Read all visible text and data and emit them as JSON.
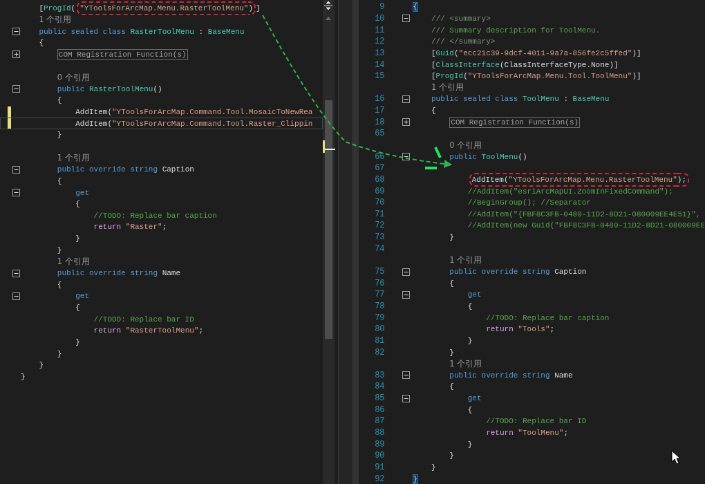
{
  "left_pane": {
    "lines": [
      {
        "children": [
          {
            "changed": false,
            "current": false,
            "tokens": [
              {
                "text": "[",
                "kind": "plain",
                "outlined": false
              },
              {
                "text": "ProgId",
                "kind": "type",
                "outlined": false
              },
              {
                "text": "(",
                "kind": "plain",
                "outlined": false
              },
              {
                "text": "\"YToolsForArcMap.Menu.RasterToolMenu\"",
                "kind": "string",
                "outlined": true
              },
              {
                "text": ")",
                "kind": "plain",
                "outlined": true
              },
              {
                "text": "]",
                "kind": "plain",
                "outlined": false
              }
            ]
          },
          {
            "changed": false,
            "current": false,
            "tokens": [
              {
                "text": "1 个引用",
                "kind": "codelens"
              }
            ]
          },
          {
            "changed": false,
            "current": false,
            "collapsed": false,
            "tokens": [
              {
                "text": "public sealed class ",
                "kind": "keyword"
              },
              {
                "text": "RasterToolMenu",
                "kind": "type"
              },
              {
                "text": " : ",
                "kind": "plain"
              },
              {
                "text": "BaseMenu",
                "kind": "type"
              }
            ]
          },
          {
            "changed": false,
            "current": false,
            "tokens": [
              {
                "text": "{",
                "kind": "plain"
              }
            ],
            "children": [
              {
                "changed": false,
                "current": false,
                "collapsed": true,
                "tokens": [
                  {
                    "text": "COM Registration Function(s)",
                    "kind": "region"
                  }
                ]
              },
              {
                "changed": false,
                "current": false
              },
              {
                "changed": false,
                "current": false,
                "tokens": [
                  {
                    "text": "0 个引用",
                    "kind": "codelens"
                  }
                ]
              },
              {
                "changed": false,
                "current": false,
                "collapsed": false,
                "tokens": [
                  {
                    "text": "public ",
                    "kind": "keyword"
                  },
                  {
                    "text": "RasterToolMenu",
                    "kind": "type"
                  },
                  {
                    "text": "()",
                    "kind": "plain"
                  }
                ]
              },
              {
                "changed": false,
                "current": false,
                "tokens": [
                  {
                    "text": "{",
                    "kind": "plain"
                  }
                ],
                "children": [
                  {
                    "changed": true,
                    "current": false,
                    "tokens": [
                      {
                        "text": "AddItem(",
                        "kind": "plain"
                      },
                      {
                        "text": "\"YToolsForArcMap.Command.Tool.MosaicToNewRea",
                        "kind": "string"
                      }
                    ]
                  },
                  {
                    "changed": true,
                    "current": true,
                    "tokens": [
                      {
                        "text": "AddItem(",
                        "kind": "plain"
                      },
                      {
                        "text": "\"YToolsForArcMap.Command.Tool.Raster_Clippin",
                        "kind": "string"
                      }
                    ]
                  }
                ]
              },
              {
                "changed": false,
                "current": false,
                "tokens": [
                  {
                    "text": "}",
                    "kind": "plain"
                  }
                ]
              },
              {
                "changed": false,
                "current": false
              },
              {
                "changed": false,
                "current": false,
                "tokens": [
                  {
                    "text": "1 个引用",
                    "kind": "codelens"
                  }
                ]
              },
              {
                "changed": false,
                "current": false,
                "collapsed": false,
                "tokens": [
                  {
                    "text": "public override string ",
                    "kind": "keyword"
                  },
                  {
                    "text": "Caption",
                    "kind": "plain"
                  }
                ]
              },
              {
                "changed": false,
                "current": false,
                "tokens": [
                  {
                    "text": "{",
                    "kind": "plain"
                  }
                ],
                "children": [
                  {
                    "changed": false,
                    "current": false,
                    "collapsed": false,
                    "tokens": [
                      {
                        "text": "get",
                        "kind": "keyword"
                      }
                    ]
                  },
                  {
                    "changed": false,
                    "current": false,
                    "tokens": [
                      {
                        "text": "{",
                        "kind": "plain"
                      }
                    ],
                    "children": [
                      {
                        "changed": false,
                        "current": false,
                        "tokens": [
                          {
                            "text": "//TODO: Replace bar caption",
                            "kind": "comment"
                          }
                        ]
                      },
                      {
                        "changed": false,
                        "current": false,
                        "tokens": [
                          {
                            "text": "return ",
                            "kind": "control"
                          },
                          {
                            "text": "\"Raster\"",
                            "kind": "string"
                          },
                          {
                            "text": ";",
                            "kind": "plain"
                          }
                        ]
                      }
                    ]
                  },
                  {
                    "changed": false,
                    "current": false,
                    "tokens": [
                      {
                        "text": "}",
                        "kind": "plain"
                      }
                    ]
                  }
                ]
              },
              {
                "changed": false,
                "current": false,
                "tokens": [
                  {
                    "text": "}",
                    "kind": "plain"
                  }
                ]
              },
              {
                "changed": false,
                "current": false,
                "tokens": [
                  {
                    "text": "1 个引用",
                    "kind": "codelens"
                  }
                ]
              },
              {
                "changed": false,
                "current": false,
                "collapsed": false,
                "tokens": [
                  {
                    "text": "public override string ",
                    "kind": "keyword"
                  },
                  {
                    "text": "Name",
                    "kind": "plain"
                  }
                ]
              },
              {
                "changed": false,
                "current": false,
                "tokens": [
                  {
                    "text": "{",
                    "kind": "plain"
                  }
                ],
                "children": [
                  {
                    "changed": false,
                    "current": false,
                    "collapsed": false,
                    "tokens": [
                      {
                        "text": "get",
                        "kind": "keyword"
                      }
                    ]
                  },
                  {
                    "changed": false,
                    "current": false,
                    "tokens": [
                      {
                        "text": "{",
                        "kind": "plain"
                      }
                    ],
                    "children": [
                      {
                        "changed": false,
                        "current": false,
                        "tokens": [
                          {
                            "text": "//TODO: Replace bar ID",
                            "kind": "comment"
                          }
                        ]
                      },
                      {
                        "changed": false,
                        "current": false,
                        "tokens": [
                          {
                            "text": "return ",
                            "kind": "control"
                          },
                          {
                            "text": "\"RasterToolMenu\"",
                            "kind": "string"
                          },
                          {
                            "text": ";",
                            "kind": "plain"
                          }
                        ]
                      }
                    ]
                  },
                  {
                    "changed": false,
                    "current": false,
                    "tokens": [
                      {
                        "text": "}",
                        "kind": "plain"
                      }
                    ]
                  }
                ]
              },
              {
                "changed": false,
                "current": false,
                "tokens": [
                  {
                    "text": "}",
                    "kind": "plain"
                  }
                ]
              }
            ]
          },
          {
            "changed": false,
            "current": false,
            "tokens": [
              {
                "text": "}",
                "kind": "plain"
              }
            ]
          }
        ]
      },
      {
        "changed": false,
        "current": false,
        "tokens": [
          {
            "text": "}",
            "kind": "plain"
          }
        ]
      }
    ]
  },
  "right_pane": {
    "lines": [
      {
        "number": "9",
        "tokens": [
          {
            "text": "{",
            "kind": "brace-match"
          }
        ],
        "children": [
          {
            "number": "10",
            "collapsed": false,
            "tokens": [
              {
                "text": "/// <summary>",
                "kind": "doc"
              }
            ]
          },
          {
            "number": "11",
            "tokens": [
              {
                "text": "///",
                "kind": "doc"
              },
              {
                "text": " Summary description for ToolMenu.",
                "kind": "comment"
              }
            ]
          },
          {
            "number": "12",
            "tokens": [
              {
                "text": "/// </summary>",
                "kind": "doc"
              }
            ]
          },
          {
            "number": "13",
            "tokens": [
              {
                "text": "[",
                "kind": "plain"
              },
              {
                "text": "Guid",
                "kind": "type"
              },
              {
                "text": "(",
                "kind": "plain"
              },
              {
                "text": "\"ecc21c39-9dcf-4011-9a7a-856fe2c5ffed\"",
                "kind": "string"
              },
              {
                "text": ")]",
                "kind": "plain"
              }
            ]
          },
          {
            "number": "14",
            "tokens": [
              {
                "text": "[",
                "kind": "plain"
              },
              {
                "text": "ClassInterface",
                "kind": "type"
              },
              {
                "text": "(ClassInterfaceType.None)]",
                "kind": "plain"
              }
            ]
          },
          {
            "number": "15",
            "tokens": [
              {
                "text": "[",
                "kind": "plain"
              },
              {
                "text": "ProgId",
                "kind": "type"
              },
              {
                "text": "(",
                "kind": "plain"
              },
              {
                "text": "\"YToolsForArcMap.Menu.Tool.ToolMenu\"",
                "kind": "string"
              },
              {
                "text": ")]",
                "kind": "plain"
              }
            ]
          },
          {
            "tokens": [
              {
                "text": "1 个引用",
                "kind": "codelens"
              }
            ]
          },
          {
            "number": "16",
            "collapsed": false,
            "tokens": [
              {
                "text": "public sealed class ",
                "kind": "keyword"
              },
              {
                "text": "ToolMenu",
                "kind": "type"
              },
              {
                "text": " : ",
                "kind": "plain"
              },
              {
                "text": "BaseMenu",
                "kind": "type"
              }
            ]
          },
          {
            "number": "17",
            "tokens": [
              {
                "text": "{",
                "kind": "plain"
              }
            ],
            "children": [
              {
                "number": "18",
                "collapsed": true,
                "tokens": [
                  {
                    "text": "COM Registration Function(s)",
                    "kind": "region"
                  }
                ]
              },
              {
                "number": "65"
              },
              {
                "tokens": [
                  {
                    "text": "0 个引用",
                    "kind": "codelens"
                  }
                ]
              },
              {
                "number": "66",
                "collapsed": false,
                "tokens": [
                  {
                    "text": "public ",
                    "kind": "keyword"
                  },
                  {
                    "text": "ToolMenu",
                    "kind": "type"
                  },
                  {
                    "text": "()",
                    "kind": "plain"
                  }
                ]
              },
              {
                "number": "67",
                "children": [
                  {
                    "number": "68",
                    "tokens": [
                      {
                        "text": "AddItem(",
                        "kind": "plain",
                        "outlined": true
                      },
                      {
                        "text": "\"YToolsForArcMap.Menu.RasterToolMenu\"",
                        "kind": "string",
                        "outlined": true
                      },
                      {
                        "text": ");",
                        "kind": "plain",
                        "outlined": true
                      }
                    ]
                  },
                  {
                    "number": "69",
                    "tokens": [
                      {
                        "text": "//AddItem(\"esriArcMapUI.ZoomInFixedCommand\");",
                        "kind": "comment"
                      }
                    ]
                  },
                  {
                    "number": "70",
                    "tokens": [
                      {
                        "text": "//BeginGroup(); //Separator",
                        "kind": "comment"
                      }
                    ]
                  },
                  {
                    "number": "71",
                    "tokens": [
                      {
                        "text": "//AddItem(\"{FBF8C3FB-0480-11D2-8D21-080009EE4E51}\",",
                        "kind": "comment"
                      }
                    ]
                  },
                  {
                    "number": "72",
                    "tokens": [
                      {
                        "text": "//AddItem(new Guid(\"FBF8C3FB-0480-11D2-8D21-080009EE",
                        "kind": "comment"
                      }
                    ]
                  }
                ]
              },
              {
                "number": "73",
                "tokens": [
                  {
                    "text": "}",
                    "kind": "plain"
                  }
                ]
              },
              {
                "number": "74"
              },
              {
                "tokens": [
                  {
                    "text": "1 个引用",
                    "kind": "codelens"
                  }
                ]
              },
              {
                "number": "75",
                "collapsed": false,
                "tokens": [
                  {
                    "text": "public override string ",
                    "kind": "keyword"
                  },
                  {
                    "text": "Caption",
                    "kind": "plain"
                  }
                ]
              },
              {
                "number": "76",
                "tokens": [
                  {
                    "text": "{",
                    "kind": "plain"
                  }
                ],
                "children": [
                  {
                    "number": "77",
                    "collapsed": false,
                    "tokens": [
                      {
                        "text": "get",
                        "kind": "keyword"
                      }
                    ]
                  },
                  {
                    "number": "78",
                    "tokens": [
                      {
                        "text": "{",
                        "kind": "plain"
                      }
                    ],
                    "children": [
                      {
                        "number": "79",
                        "tokens": [
                          {
                            "text": "//TODO: Replace bar caption",
                            "kind": "comment"
                          }
                        ]
                      },
                      {
                        "number": "80",
                        "tokens": [
                          {
                            "text": "return ",
                            "kind": "control"
                          },
                          {
                            "text": "\"Tools\"",
                            "kind": "string"
                          },
                          {
                            "text": ";",
                            "kind": "plain"
                          }
                        ]
                      }
                    ]
                  },
                  {
                    "number": "81",
                    "tokens": [
                      {
                        "text": "}",
                        "kind": "plain"
                      }
                    ]
                  }
                ]
              },
              {
                "number": "82",
                "tokens": [
                  {
                    "text": "}",
                    "kind": "plain"
                  }
                ]
              },
              {
                "tokens": [
                  {
                    "text": "1 个引用",
                    "kind": "codelens"
                  }
                ]
              },
              {
                "number": "83",
                "collapsed": false,
                "tokens": [
                  {
                    "text": "public override string ",
                    "kind": "keyword"
                  },
                  {
                    "text": "Name",
                    "kind": "plain"
                  }
                ]
              },
              {
                "number": "84",
                "tokens": [
                  {
                    "text": "{",
                    "kind": "plain"
                  }
                ],
                "children": [
                  {
                    "number": "85",
                    "collapsed": false,
                    "tokens": [
                      {
                        "text": "get",
                        "kind": "keyword"
                      }
                    ]
                  },
                  {
                    "number": "86",
                    "tokens": [
                      {
                        "text": "{",
                        "kind": "plain"
                      }
                    ],
                    "children": [
                      {
                        "number": "87",
                        "tokens": [
                          {
                            "text": "//TODO: Replace bar ID",
                            "kind": "comment"
                          }
                        ]
                      },
                      {
                        "number": "88",
                        "tokens": [
                          {
                            "text": "return ",
                            "kind": "control"
                          },
                          {
                            "text": "\"ToolMenu\"",
                            "kind": "string"
                          },
                          {
                            "text": ";",
                            "kind": "plain"
                          }
                        ]
                      }
                    ]
                  },
                  {
                    "number": "89",
                    "tokens": [
                      {
                        "text": "}",
                        "kind": "plain"
                      }
                    ]
                  }
                ]
              },
              {
                "number": "90",
                "tokens": [
                  {
                    "text": "}",
                    "kind": "plain"
                  }
                ]
              }
            ]
          },
          {
            "number": "91",
            "tokens": [
              {
                "text": "}",
                "kind": "plain"
              }
            ]
          }
        ]
      },
      {
        "number": "92",
        "tokens": [
          {
            "text": "}",
            "kind": "brace-match"
          }
        ]
      }
    ]
  }
}
